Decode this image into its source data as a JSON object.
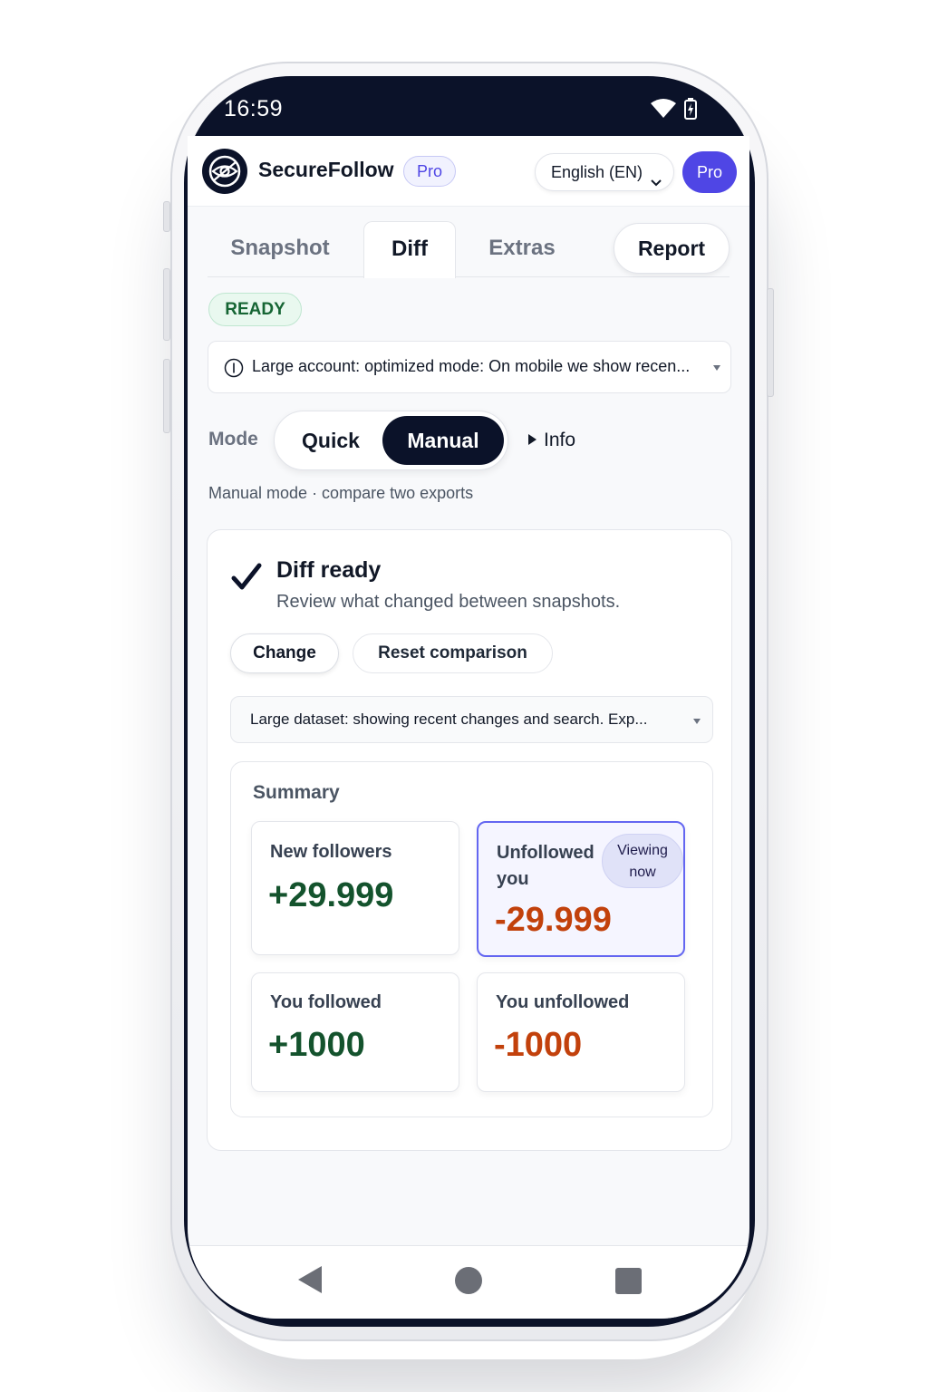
{
  "status_bar": {
    "time": "16:59",
    "icons": [
      "wifi-icon",
      "battery-icon"
    ]
  },
  "header": {
    "app_name": "SecureFollow",
    "plan_tag": "Pro",
    "language": "English (EN)",
    "pro_button": "Pro",
    "logo_icon": "radar-eye-icon"
  },
  "tabs": [
    {
      "label": "Snapshot",
      "active": false
    },
    {
      "label": "Diff",
      "active": true
    },
    {
      "label": "Extras",
      "active": false
    },
    {
      "label": "Report",
      "active": false
    }
  ],
  "status_badge": "READY",
  "notice": {
    "icon": "info-circle-icon",
    "text": "Large account: optimized mode: On mobile we show recen..."
  },
  "mode": {
    "label": "Mode",
    "options": [
      "Quick",
      "Manual"
    ],
    "selected": "Manual",
    "info_toggle": "Info",
    "description": "Manual mode · compare two exports"
  },
  "diff_card": {
    "title": "Diff ready",
    "subtitle": "Review what changed between snapshots.",
    "change_button": "Change",
    "reset_button": "Reset comparison",
    "dataset_notice": "Large dataset: showing recent changes and search. Exp..."
  },
  "summary": {
    "title": "Summary",
    "stats": [
      {
        "label": "New followers",
        "value": "+29.999",
        "tone": "positive"
      },
      {
        "label_line1": "Unfollowed",
        "label_line2": "you",
        "value": "-29.999",
        "tone": "negative",
        "badge_line1": "Viewing",
        "badge_line2": "now"
      },
      {
        "label": "You followed",
        "value": "+1000",
        "tone": "positive"
      },
      {
        "label": "You unfollowed",
        "value": "-1000",
        "tone": "negative"
      }
    ]
  },
  "colors": {
    "accent": "#4f46e5",
    "dark": "#0b1229",
    "positive": "#14532d",
    "negative": "#c2410c",
    "ready": "#166534"
  },
  "nav_bar": {
    "icons": [
      "back-icon",
      "home-icon",
      "recents-icon"
    ]
  }
}
